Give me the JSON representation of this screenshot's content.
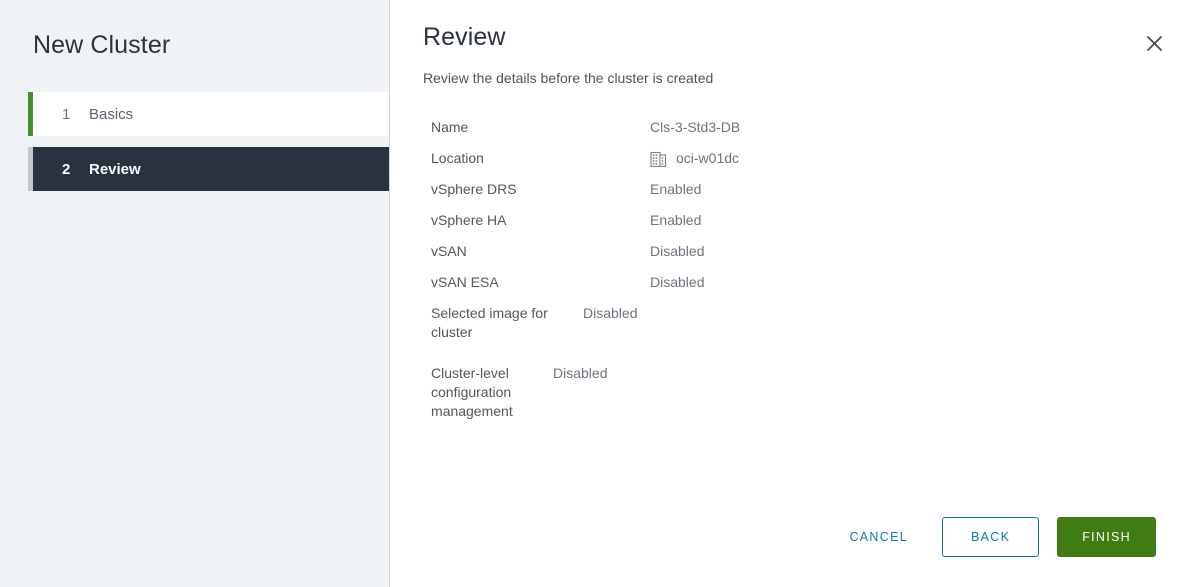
{
  "wizard": {
    "title": "New Cluster",
    "steps": [
      {
        "number": "1",
        "label": "Basics",
        "state": "done"
      },
      {
        "number": "2",
        "label": "Review",
        "state": "active"
      }
    ]
  },
  "page": {
    "title": "Review",
    "subtitle": "Review the details before the cluster is created",
    "close_icon": "close-icon"
  },
  "details": [
    {
      "label": "Name",
      "value": "Cls-3-Std3-DB",
      "icon": null
    },
    {
      "label": "Location",
      "value": "oci-w01dc",
      "icon": "datacenter-icon"
    },
    {
      "label": "vSphere DRS",
      "value": "Enabled",
      "icon": null
    },
    {
      "label": "vSphere HA",
      "value": "Enabled",
      "icon": null
    },
    {
      "label": "vSAN",
      "value": "Disabled",
      "icon": null
    },
    {
      "label": "vSAN ESA",
      "value": "Disabled",
      "icon": null
    },
    {
      "label": "Selected image for cluster",
      "value": "Disabled",
      "icon": null
    },
    {
      "label": "Cluster-level configuration management",
      "value": "Disabled",
      "icon": null
    }
  ],
  "footer": {
    "cancel_label": "CANCEL",
    "back_label": "BACK",
    "finish_label": "FINISH"
  },
  "colors": {
    "accent_green": "#489024",
    "finish_green": "#417c13",
    "link_blue": "#0c7ba8",
    "active_step_bg": "#29323f",
    "sidebar_bg": "#eff3f6",
    "inactive_step_bar": "#bfc9ce"
  }
}
